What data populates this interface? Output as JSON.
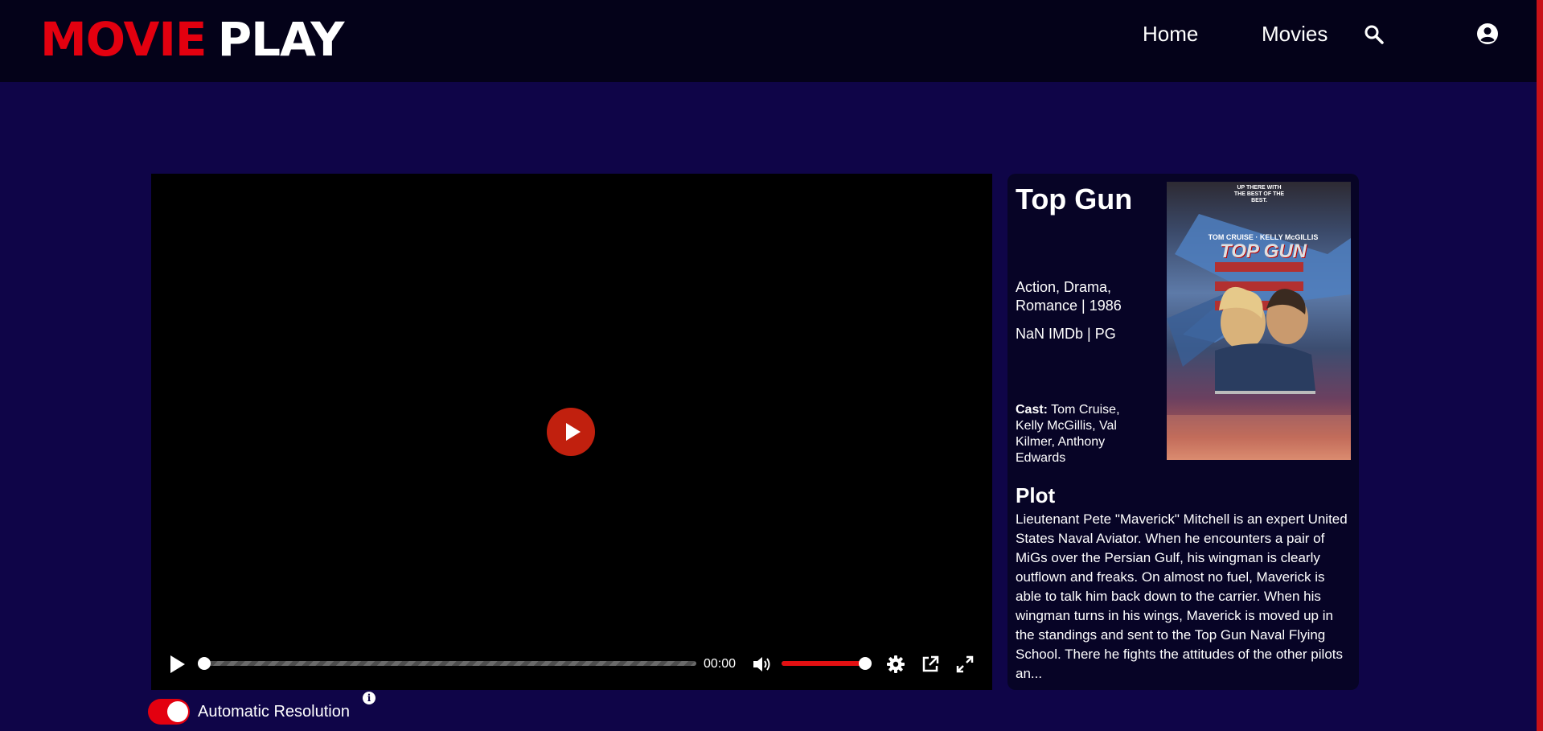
{
  "brand": {
    "part1": "MOVIE",
    "part2": "PLAY",
    "red": "#e3000f"
  },
  "nav": {
    "home": "Home",
    "movies": "Movies"
  },
  "player": {
    "current_time": "00:00",
    "progress": 0,
    "volume": 1.0,
    "accent": "#e31012"
  },
  "resolution": {
    "label": "Automatic Resolution",
    "enabled": true,
    "info_icon": "i"
  },
  "movie": {
    "title": "Top Gun",
    "genres_year": "Action, Drama, Romance | 1986",
    "rating_line": "NaN IMDb | PG",
    "cast_label": "Cast:",
    "cast": "Tom Cruise, Kelly McGillis, Val Kilmer, Anthony Edwards",
    "plot_heading": "Plot",
    "plot": "Lieutenant Pete \"Maverick\" Mitchell is an expert United States Naval Aviator. When he encounters a pair of MiGs over the Persian Gulf, his wingman is clearly outflown and freaks. On almost no fuel, Maverick is able to talk him back down to the carrier. When his wingman turns in his wings, Maverick is moved up in the standings and sent to the Top Gun Naval Flying School. There he fights the attitudes of the other pilots an...",
    "poster": {
      "tagline": "UP THERE WITH THE BEST OF THE BEST.",
      "actors": "TOM CRUISE · KELLY McGILLIS",
      "title": "TOP GUN"
    }
  }
}
